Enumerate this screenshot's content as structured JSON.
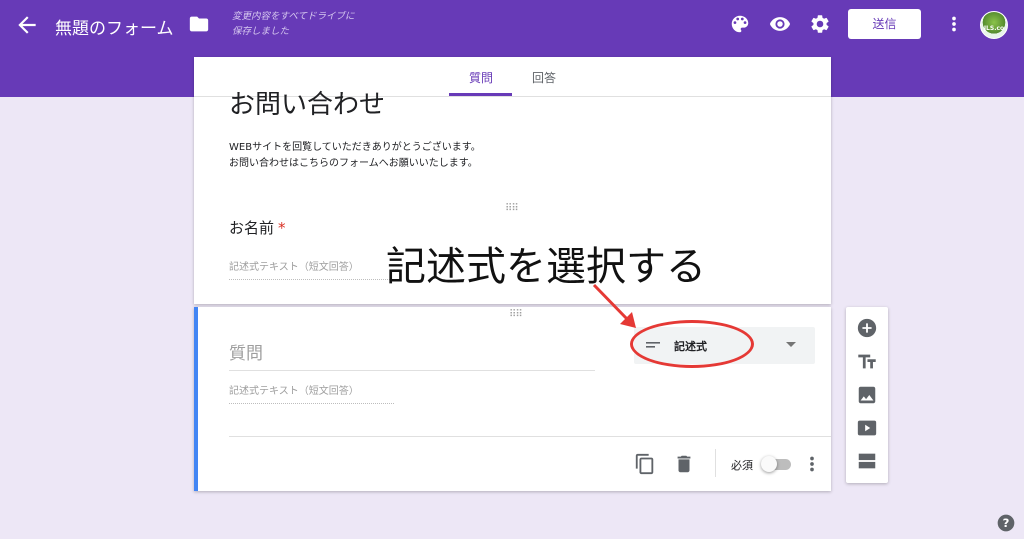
{
  "header": {
    "title": "無題のフォーム",
    "save_status_line1": "変更内容をすべてドライブに",
    "save_status_line2": "保存しました",
    "send_label": "送信",
    "avatar_text": "JLS.co",
    "icons": [
      "back-arrow-icon",
      "folder-icon",
      "palette-icon",
      "eye-icon",
      "gear-icon",
      "more-vert-icon"
    ],
    "accent_color": "#673ab7"
  },
  "tabs": [
    {
      "label": "質問",
      "active": true
    },
    {
      "label": "回答",
      "active": false
    }
  ],
  "form": {
    "title": "お問い合わせ",
    "desc_line1": "WEBサイトを回覧していただきありがとうございます。",
    "desc_line2": "お問い合わせはこちらのフォームへお願いいたします。"
  },
  "name_question": {
    "label": "お名前",
    "required_mark": "*",
    "answer_placeholder": "記述式テキスト（短文回答）"
  },
  "new_question": {
    "title_placeholder": "質問",
    "type_label": "記述式",
    "answer_placeholder": "記述式テキスト（短文回答）",
    "required_label": "必須",
    "required": false
  },
  "annotation": {
    "text": "記述式を選択する",
    "color": "#e53935"
  },
  "side_toolbar": [
    "add-question-icon",
    "add-title-icon",
    "add-image-icon",
    "add-video-icon",
    "add-section-icon"
  ]
}
